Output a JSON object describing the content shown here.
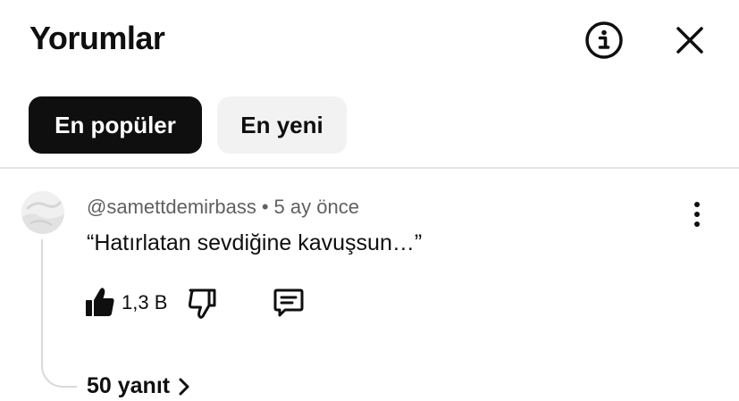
{
  "header": {
    "title": "Yorumlar",
    "info_icon": "info-circle-icon",
    "close_icon": "close-icon"
  },
  "filters": {
    "chips": [
      {
        "label": "En popüler",
        "selected": true
      },
      {
        "label": "En yeni",
        "selected": false
      }
    ]
  },
  "comment": {
    "author": "@samettdemirbass",
    "separator": "•",
    "time": "5 ay önce",
    "text": "“Hatırlatan sevdiğine kavuşsun…”",
    "like_count": "1,3 B",
    "icons": {
      "like": "thumbs-up-icon",
      "dislike": "thumbs-down-icon",
      "reply": "comment-reply-icon",
      "more": "more-vertical-icon"
    },
    "replies_label": "50 yanıt"
  },
  "colors": {
    "text_primary": "#0f0f0f",
    "text_secondary": "#606060",
    "chip_active_bg": "#0f0f0f",
    "chip_inactive_bg": "#f2f2f2",
    "divider": "#e5e5e5"
  }
}
